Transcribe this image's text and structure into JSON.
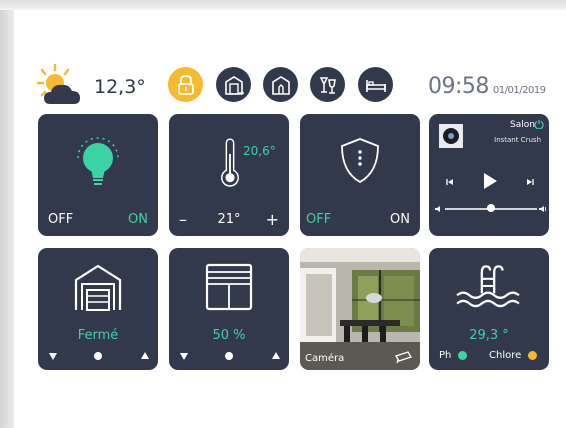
{
  "header": {
    "weather_icon": "partly-cloudy-sun-icon",
    "temperature": "12,3°",
    "modes": [
      {
        "icon": "lock-icon",
        "active": true
      },
      {
        "icon": "garage-house-icon",
        "active": false
      },
      {
        "icon": "house-icon",
        "active": false
      },
      {
        "icon": "party-drinks-icon",
        "active": false
      },
      {
        "icon": "bed-icon",
        "active": false
      }
    ],
    "time": "09:58",
    "date": "01/01/2019"
  },
  "tiles": {
    "light": {
      "icon": "lightbulb-icon",
      "off_label": "OFF",
      "on_label": "ON",
      "state": "on"
    },
    "thermostat": {
      "icon": "thermometer-icon",
      "current_temp": "20,6°",
      "minus_label": "–",
      "setpoint": "21°",
      "plus_label": "+"
    },
    "alarm": {
      "icon": "shield-icon",
      "off_label": "OFF",
      "on_label": "ON",
      "state": "off"
    },
    "music": {
      "room": "Salon",
      "track": "Instant Crush",
      "power_icon": "power-icon",
      "prev_icon": "previous-icon",
      "play_icon": "play-icon",
      "next_icon": "next-icon",
      "volume": 0.5
    },
    "garage": {
      "icon": "garage-icon",
      "status": "Fermé"
    },
    "shutter": {
      "icon": "shutter-icon",
      "level": "50 %"
    },
    "camera": {
      "label": "Caméra"
    },
    "pool": {
      "icon": "pool-icon",
      "temperature": "29,3 °",
      "ph_label": "Ph",
      "ph_color": "#3bd3a5",
      "chlore_label": "Chlore",
      "chlore_color": "#f7b92e"
    }
  },
  "colors": {
    "tile": "#33394d",
    "accent_green": "#3bd3a5",
    "accent_yellow": "#f7b92e"
  }
}
